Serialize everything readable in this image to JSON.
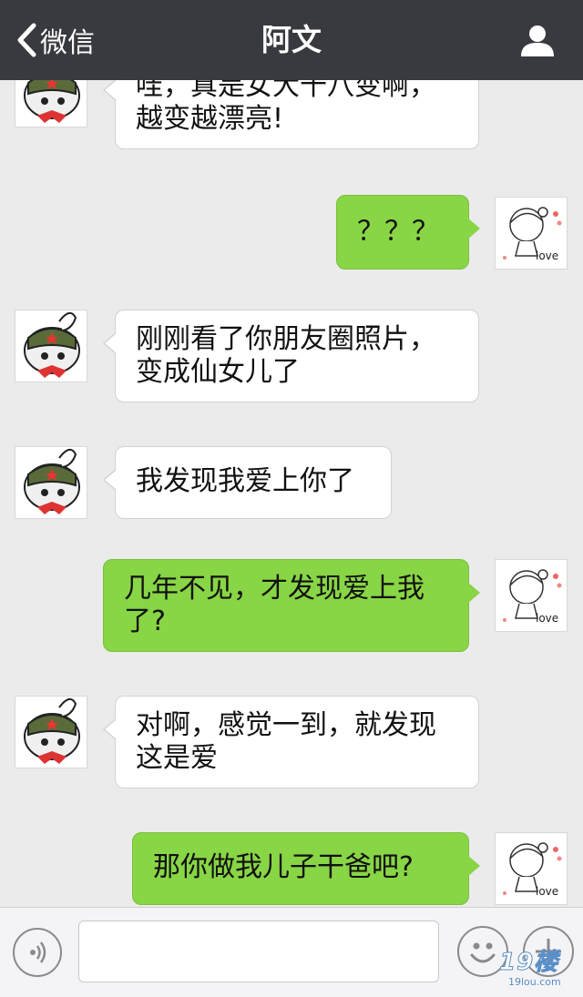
{
  "header": {
    "back_label": "微信",
    "title": "阿文",
    "profile_icon": "person-icon"
  },
  "messages": [
    {
      "side": "in",
      "lines": [
        "哇，真是女大十八变啊，",
        "越变越漂亮!"
      ]
    },
    {
      "side": "out",
      "lines": [
        "？？？"
      ]
    },
    {
      "side": "in",
      "lines": [
        "刚刚看了你朋友圈照片，",
        "变成仙女儿了"
      ]
    },
    {
      "side": "in",
      "lines": [
        "我发现我爱上你了"
      ]
    },
    {
      "side": "out",
      "lines": [
        "几年不见，才发现爱上我",
        "了?"
      ]
    },
    {
      "side": "in",
      "lines": [
        "对啊，感觉一到，就发现",
        "这是爱"
      ]
    },
    {
      "side": "out",
      "lines": [
        "那你做我儿子干爸吧?"
      ]
    }
  ],
  "avatars": {
    "contact": "rabbit-hat-avatar",
    "self": "girl-love-avatar",
    "self_caption": "love"
  },
  "input_bar": {
    "voice_icon": "voice-icon",
    "input_value": "",
    "emoji_icon": "smiley-icon",
    "plus_icon": "plus-icon"
  },
  "watermark": {
    "text": "19楼",
    "sub": "19lou.com"
  },
  "colors": {
    "topbar": "#393a3f",
    "background": "#ebebeb",
    "outgoing_bubble": "#88d545",
    "incoming_bubble": "#ffffff"
  }
}
